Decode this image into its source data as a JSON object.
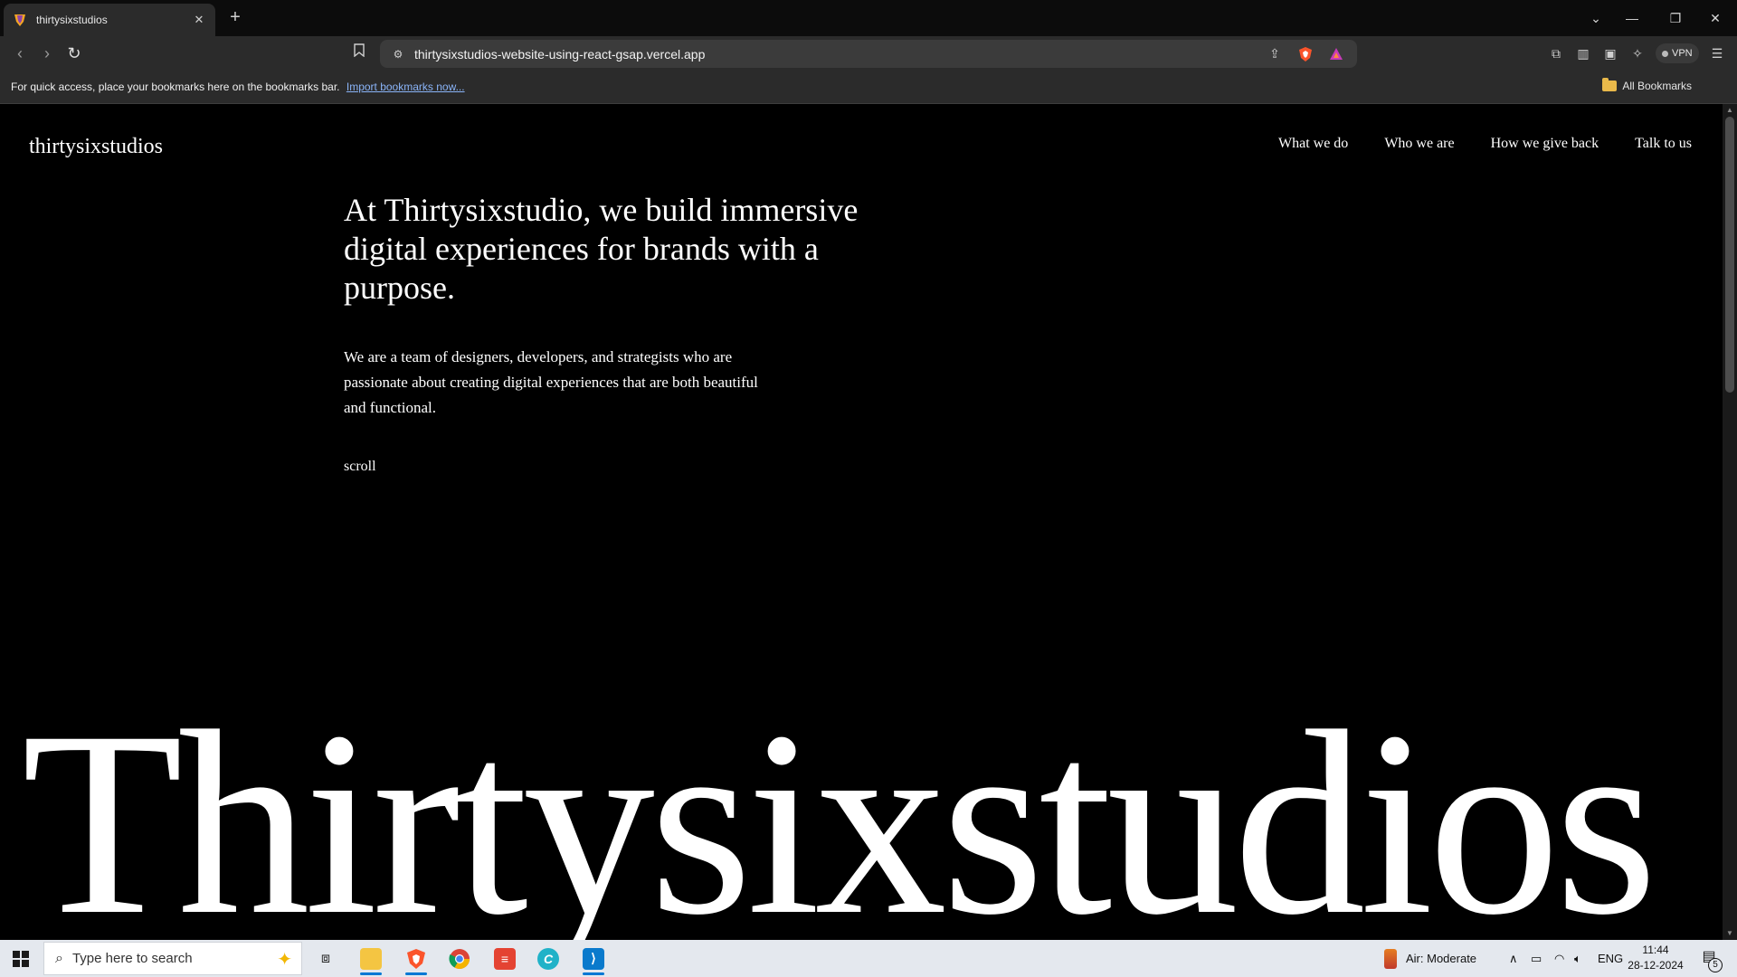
{
  "browser": {
    "tab_title": "thirtysixstudios",
    "tab_close": "✕",
    "new_tab": "+",
    "url": "thirtysixstudios-website-using-react-gsap.vercel.app",
    "vpn_label": "VPN",
    "bookmarks_prompt": "For quick access, place your bookmarks here on the bookmarks bar.",
    "import_link": "Import bookmarks now...",
    "all_bookmarks": "All Bookmarks",
    "window_controls": {
      "dropdown": "⌄",
      "minimize": "—",
      "restore": "❐",
      "close": "✕"
    }
  },
  "site": {
    "logo": "thirtysixstudios",
    "nav": [
      "What we do",
      "Who we are",
      "How we give back",
      "Talk to us"
    ],
    "hero_title": "At Thirtysixstudio, we build immersive digital experiences for brands with a purpose.",
    "hero_subtitle": "We are a team of designers, developers, and strategists who are passionate about creating digital experiences that are both beautiful and functional.",
    "scroll_label": "scroll",
    "big_word": "Thirtysixstudios"
  },
  "taskbar": {
    "search_placeholder": "Type here to search",
    "weather": "Air: Moderate",
    "language": "ENG",
    "time": "11:44",
    "date": "28-12-2024",
    "notification_count": "5"
  },
  "icons": {
    "tab_favicon": "brave-lion-icon",
    "back": "back-arrow-icon",
    "forward": "forward-arrow-icon",
    "reload": "reload-icon",
    "bookmark": "bookmark-icon",
    "share": "share-icon",
    "brave_shields": "brave-shield-icon",
    "rewards": "brave-rewards-icon",
    "extensions": "puzzle-icon",
    "sidebar": "sidebar-icon",
    "wallet": "wallet-icon",
    "leo": "leo-ai-icon",
    "menu": "hamburger-menu-icon"
  },
  "colors": {
    "page_bg": "#000000",
    "page_text": "#ffffff",
    "chrome_bg": "#2b2b2b",
    "link": "#8ab4f8",
    "taskbar_bg": "#e4e8ee"
  }
}
